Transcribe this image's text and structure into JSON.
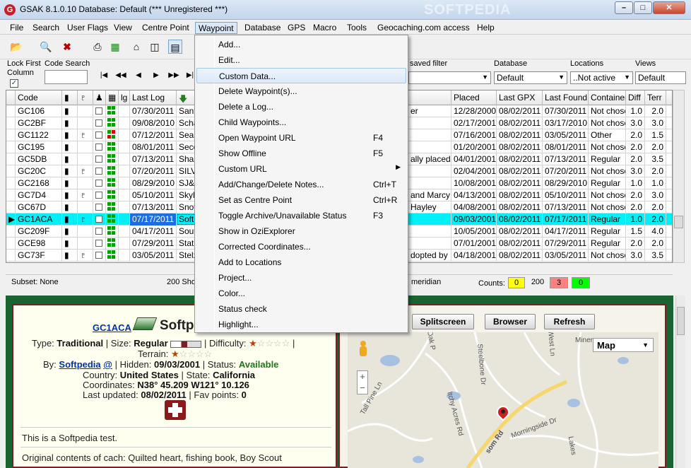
{
  "window": {
    "title": "GSAK 8.1.0.10    Database: Default    (*** Unregistered ***)",
    "min": "–",
    "max": "□",
    "close": "✕",
    "watermark": "SOFTPEDIA"
  },
  "menubar": [
    "File",
    "Search",
    "User Flags",
    "View",
    "Centre Point",
    "Waypoint",
    "Database",
    "GPS",
    "Macro",
    "Tools",
    "Geocaching.com access",
    "Help"
  ],
  "filters": {
    "lock_first_column": "Lock First\nColumn",
    "code_search": "Code Search",
    "saved_filter": "saved filter",
    "database_label": "Database",
    "database_value": "Default",
    "locations_label": "Locations",
    "locations_value": "..Not active",
    "views_label": "Views",
    "views_value": "Default"
  },
  "grid": {
    "headers": [
      "Code",
      "",
      "",
      "",
      "",
      "lg",
      "Last Log",
      "",
      "",
      "Placed",
      "Last GPX",
      "Last Found",
      "Container",
      "Diff",
      "Terr"
    ],
    "rows": [
      {
        "code": "GC106",
        "travel": false,
        "person": false,
        "lastlog": "07/30/2011",
        "name": "Sant",
        "owner": "er",
        "placed": "12/28/2000",
        "gpx": "08/02/2011",
        "found": "07/30/2011",
        "container": "Not chose",
        "diff": "1.0",
        "terr": "2.0",
        "logs": "gggg"
      },
      {
        "code": "GC2BF",
        "travel": false,
        "person": false,
        "lastlog": "09/08/2010",
        "name": "Scha",
        "owner": "",
        "placed": "02/17/2001",
        "gpx": "08/02/2011",
        "found": "03/17/2010",
        "container": "Not chose",
        "diff": "3.0",
        "terr": "3.0",
        "logs": "gggg"
      },
      {
        "code": "GC1122",
        "travel": false,
        "person": true,
        "lastlog": "07/12/2011",
        "name": "Sea",
        "owner": "",
        "placed": "07/16/2001",
        "gpx": "08/02/2011",
        "found": "03/05/2011",
        "container": "Other",
        "diff": "2.0",
        "terr": "1.5",
        "logs": "grrg"
      },
      {
        "code": "GC195",
        "travel": false,
        "person": false,
        "lastlog": "08/01/2011",
        "name": "Seco",
        "owner": "",
        "placed": "01/20/2001",
        "gpx": "08/02/2011",
        "found": "08/01/2011",
        "container": "Not chose",
        "diff": "2.0",
        "terr": "2.0",
        "logs": "gggg"
      },
      {
        "code": "GC5DB",
        "travel": false,
        "person": false,
        "lastlog": "07/13/2011",
        "name": "Shak",
        "owner": "ally placed b",
        "placed": "04/01/2001",
        "gpx": "08/02/2011",
        "found": "07/13/2011",
        "container": "Regular",
        "diff": "2.0",
        "terr": "3.5",
        "logs": "gggg"
      },
      {
        "code": "GC20C",
        "travel": false,
        "person": true,
        "lastlog": "07/20/2011",
        "name": "SILV",
        "owner": "",
        "placed": "02/04/2001",
        "gpx": "08/02/2011",
        "found": "07/20/2011",
        "container": "Not chose",
        "diff": "3.0",
        "terr": "2.0",
        "logs": "gggg"
      },
      {
        "code": "GC2168",
        "travel": false,
        "person": false,
        "lastlog": "08/29/2010",
        "name": "SJ&E",
        "owner": "",
        "placed": "10/08/2001",
        "gpx": "08/02/2011",
        "found": "08/29/2010",
        "container": "Regular",
        "diff": "1.0",
        "terr": "1.0",
        "logs": "gggg"
      },
      {
        "code": "GC7D4",
        "travel": false,
        "person": true,
        "lastlog": "05/10/2011",
        "name": "Skyli",
        "owner": "and Marcy",
        "placed": "04/13/2001",
        "gpx": "08/02/2011",
        "found": "05/10/2011",
        "container": "Not chose",
        "diff": "2.0",
        "terr": "3.0",
        "logs": "gggg"
      },
      {
        "code": "GC67D",
        "travel": false,
        "person": false,
        "lastlog": "07/13/2011",
        "name": "Snov",
        "owner": "Hayley",
        "placed": "04/08/2001",
        "gpx": "08/02/2011",
        "found": "07/13/2011",
        "container": "Not chose",
        "diff": "2.0",
        "terr": "2.0",
        "logs": "gggg"
      },
      {
        "code": "GC1ACA",
        "travel": true,
        "person": true,
        "lastlog": "07/17/2011",
        "name": "Softp",
        "owner": "",
        "placed": "09/03/2001",
        "gpx": "08/02/2011",
        "found": "07/17/2011",
        "container": "Regular",
        "diff": "1.0",
        "terr": "2.0",
        "logs": "gggg",
        "selected": true
      },
      {
        "code": "GC209F",
        "travel": false,
        "person": false,
        "lastlog": "04/17/2011",
        "name": "Sout",
        "owner": "",
        "placed": "10/05/2001",
        "gpx": "08/02/2011",
        "found": "04/17/2011",
        "container": "Regular",
        "diff": "1.5",
        "terr": "4.0",
        "logs": "gggg"
      },
      {
        "code": "GCE98",
        "travel": false,
        "person": false,
        "lastlog": "07/29/2011",
        "name": "State",
        "owner": "",
        "placed": "07/01/2001",
        "gpx": "08/02/2011",
        "found": "07/29/2011",
        "container": "Regular",
        "diff": "2.0",
        "terr": "2.0",
        "logs": "gggg"
      },
      {
        "code": "GC73F",
        "travel": false,
        "person": true,
        "lastlog": "03/05/2011",
        "name": "Stelz",
        "owner": "dopted by N",
        "placed": "04/18/2001",
        "gpx": "08/02/2011",
        "found": "03/05/2011",
        "container": "Not chose",
        "diff": "3.0",
        "terr": "3.5",
        "logs": "gggg"
      }
    ]
  },
  "status": {
    "subset": "Subset: None",
    "shown": "200 Sho",
    "meridian": "meridian",
    "counts_label": "Counts:",
    "c1": "0",
    "c2": "200",
    "c3": "3",
    "c4": "0"
  },
  "waypoint_menu": [
    {
      "label": "Add...",
      "shortcut": ""
    },
    {
      "label": "Edit...",
      "shortcut": ""
    },
    {
      "label": "Custom Data...",
      "shortcut": "",
      "highlight": true
    },
    {
      "label": "Delete Waypoint(s)...",
      "shortcut": ""
    },
    {
      "label": "Delete a Log...",
      "shortcut": ""
    },
    {
      "label": "Child Waypoints...",
      "shortcut": ""
    },
    {
      "label": "Open Waypoint URL",
      "shortcut": "F4"
    },
    {
      "label": "Show Offline",
      "shortcut": "F5"
    },
    {
      "label": "Custom URL",
      "shortcut": "",
      "submenu": true
    },
    {
      "label": "Add/Change/Delete Notes...",
      "shortcut": "Ctrl+T"
    },
    {
      "label": "Set as Centre Point",
      "shortcut": "Ctrl+R"
    },
    {
      "label": "Toggle Archive/Unavailable Status",
      "shortcut": "F3"
    },
    {
      "label": "Show in OziExplorer",
      "shortcut": ""
    },
    {
      "label": "Corrected Coordinates...",
      "shortcut": ""
    },
    {
      "label": "Add to Locations",
      "shortcut": ""
    },
    {
      "label": "Project...",
      "shortcut": ""
    },
    {
      "label": "Color...",
      "shortcut": ""
    },
    {
      "label": "Status check",
      "shortcut": ""
    },
    {
      "label": "Highlight...",
      "shortcut": ""
    }
  ],
  "cache": {
    "code": "GC1ACA",
    "name": "Softp",
    "type_label": "Type:",
    "type": "Traditional",
    "size_label": "| Size:",
    "size": "Regular",
    "difficulty_label": "| Difficulty:",
    "terrain_label": "Terrain:",
    "by_label": "By:",
    "owner": "Softpedia",
    "owner_suffix": "@",
    "hidden_label": "| Hidden:",
    "hidden": "09/03/2001",
    "status_label": "| Status:",
    "status": "Available",
    "country_label": "Country:",
    "country": "United States",
    "state_label": "| State:",
    "state": "California",
    "coords_label": "Coordinates:",
    "coords": "N38° 45.209 W121° 10.126",
    "updated_label": "Last updated:",
    "updated": "08/02/2011",
    "fav_label": "| Fav points:",
    "fav": "0",
    "description": "This is a Softpedia test.",
    "contents": "Original contents of cach: Quilted heart, fishing book, Boy Scout"
  },
  "map": {
    "splitscreen": "Splitscreen",
    "browser": "Browser",
    "refresh": "Refresh",
    "map_type": "Map",
    "roads": [
      "Oak P",
      "Tall Pine Ln",
      "ltchy Acres Rd",
      "Steelbone Dr",
      "West Ln",
      "Miners",
      "Morningside Dr",
      "Lakes",
      "som Rd"
    ]
  },
  "colors": {
    "selected_row": "#00f0f8",
    "panel_border": "#7a2020",
    "bottom_bg": "#1a6432",
    "count_yellow": "#ffff00",
    "count_red": "#ff8080",
    "count_green": "#00ff00"
  }
}
